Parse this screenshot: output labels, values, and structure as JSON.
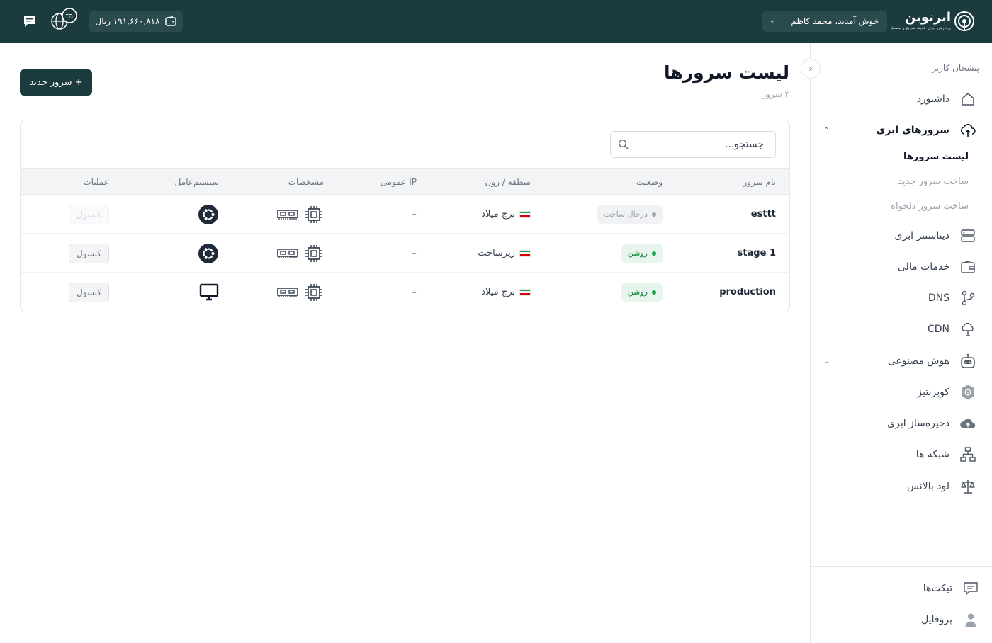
{
  "topbar": {
    "logo_name": "ابرنوین",
    "logo_tagline": "پردازش ابری جدید، سریع و مطمئن",
    "welcome_text": "خوش آمدید، محمد کاظم",
    "balance_text": "۱۹۱,۶۶۰,۸۱۸ ریال",
    "lang_badge": "fa"
  },
  "sidebar": {
    "section_title": "پیشخان کاربر",
    "items": [
      {
        "label": "داشبورد",
        "icon": "home-icon"
      },
      {
        "label": "سرورهای ابری",
        "icon": "cloud-icon",
        "expanded": true
      },
      {
        "label": "دیتاسنتر ابری",
        "icon": "server-icon"
      },
      {
        "label": "خدمات مالی",
        "icon": "wallet-icon"
      },
      {
        "label": "DNS",
        "icon": "git-branch-icon"
      },
      {
        "label": "CDN",
        "icon": "cdn-icon"
      },
      {
        "label": "هوش مصنوعی",
        "icon": "robot-icon"
      },
      {
        "label": "کوبرنتیز",
        "icon": "kubernetes-icon"
      },
      {
        "label": "ذخیره‌ساز ابری",
        "icon": "cloud-upload-icon"
      },
      {
        "label": "شبکه ها",
        "icon": "network-icon"
      },
      {
        "label": "لود بالانس",
        "icon": "scale-icon"
      }
    ],
    "subitems": [
      {
        "label": "لیست سرورها",
        "active": true
      },
      {
        "label": "ساخت سرور جدید",
        "active": false
      },
      {
        "label": "ساخت سرور دلخواه",
        "active": false
      }
    ],
    "bottom_items": [
      {
        "label": "تیکت‌ها",
        "icon": "ticket-icon"
      },
      {
        "label": "پروفایل",
        "icon": "user-icon"
      }
    ]
  },
  "main": {
    "title": "لیست سرورها",
    "subtitle": "۳ سرور",
    "new_server_button": "+ سرور جدید",
    "search_placeholder": "جستجو..."
  },
  "table": {
    "columns": {
      "name": "نام سرور",
      "status": "وضعیت",
      "zone": "منطقه / زون",
      "ip": "IP عمومی",
      "specs": "مشخصات",
      "os": "سیستم‌عامل",
      "actions": "عملیات"
    },
    "rows": [
      {
        "name": "esttt",
        "status": "درحال ساخت",
        "status_type": "building",
        "zone": "برج میلاد",
        "ip": "–",
        "os": "ubuntu-icon",
        "action": "کنسول",
        "action_enabled": false
      },
      {
        "name": "stage 1",
        "status": "روشن",
        "status_type": "on",
        "zone": "زیرساخت",
        "ip": "–",
        "os": "ubuntu-icon",
        "action": "کنسول",
        "action_enabled": true
      },
      {
        "name": "production",
        "status": "روشن",
        "status_type": "on",
        "zone": "برج میلاد",
        "ip": "–",
        "os": "monitor-icon",
        "action": "کنسول",
        "action_enabled": true
      }
    ]
  },
  "colors": {
    "brand_dark": "#1c3b3e",
    "status_on": "#16a34a",
    "status_building": "#9ca3af"
  }
}
